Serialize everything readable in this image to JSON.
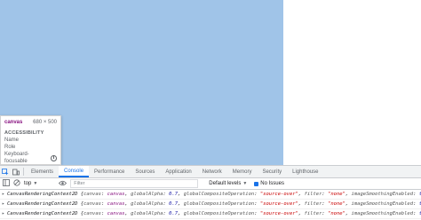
{
  "canvas": {
    "color": "#a0c4e8"
  },
  "inspect_tooltip": {
    "tag": "canvas",
    "size": "680 × 500",
    "section": "ACCESSIBILITY",
    "rows": [
      "Name",
      "Role",
      "Keyboard-focusable"
    ]
  },
  "devtools": {
    "tabs": [
      "Elements",
      "Console",
      "Performance",
      "Sources",
      "Application",
      "Network",
      "Memory",
      "Security",
      "Lighthouse"
    ],
    "active_tab": "Console",
    "context": "top",
    "filter_placeholder": "Filter",
    "levels_label": "Default levels",
    "issues_label": "No Issues",
    "log_lines": [
      {
        "type": "CanvasRenderingContext2D",
        "canvas": "canvas",
        "globalAlpha": "0.7",
        "composite": "\"source-over\"",
        "filter": "\"none\"",
        "smoothing": "true"
      },
      {
        "type": "CanvasRenderingContext2D",
        "canvas": "canvas",
        "globalAlpha": "0.7",
        "composite": "\"source-over\"",
        "filter": "\"none\"",
        "smoothing": "true"
      },
      {
        "type": "CanvasRenderingContext2D",
        "canvas": "canvas",
        "globalAlpha": "0.7",
        "composite": "\"source-over\"",
        "filter": "\"none\"",
        "smoothing": "true"
      }
    ]
  }
}
